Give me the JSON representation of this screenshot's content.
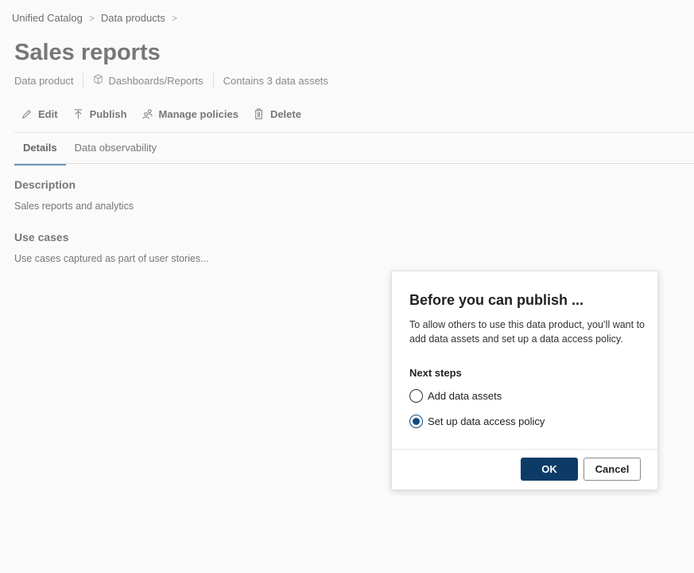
{
  "breadcrumb": [
    "Unified Catalog",
    "Data products"
  ],
  "title": "Sales reports",
  "meta": {
    "type": "Data product",
    "category": "Dashboards/Reports",
    "assets": "Contains 3 data assets"
  },
  "toolbar": {
    "edit": "Edit",
    "publish": "Publish",
    "manage": "Manage policies",
    "delete": "Delete"
  },
  "tabs": [
    "Details",
    "Data observability"
  ],
  "description": {
    "label": "Description",
    "value": "Sales reports and analytics"
  },
  "use_cases": {
    "label": "Use cases",
    "value": "Use cases captured as part of user stories..."
  },
  "dialog": {
    "title": "Before you can publish ...",
    "message": "To allow others to use this data product, you’ll want to add data assets and set up a data access policy.",
    "next_steps": "Next steps",
    "options": [
      "Add data assets",
      "Set up data access policy"
    ],
    "selected": 1,
    "ok": "OK",
    "cancel": "Cancel"
  }
}
